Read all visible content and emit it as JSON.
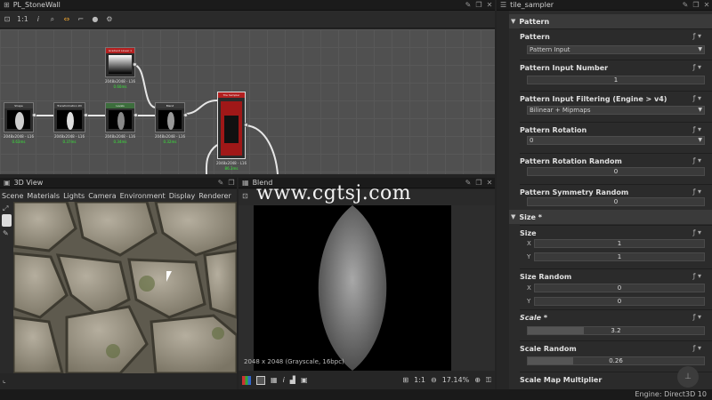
{
  "graph": {
    "title": "PL_StoneWall",
    "toolbar": [
      "1:1",
      "i",
      "⌕",
      "⇔",
      "⌐",
      "●",
      "⚙"
    ],
    "nodes": [
      {
        "header": "Gradient Linear 1",
        "label": "2048x2048 - L16",
        "time": "0.60ms"
      },
      {
        "header": "Shape",
        "label": "2048x2048 - L16",
        "time": "0.63ms"
      },
      {
        "header": "Transformation 2D",
        "label": "2048x2048 - L16",
        "time": "0.37ms"
      },
      {
        "header": "Levels",
        "label": "2048x2048 - L16",
        "time": "0.34ms"
      },
      {
        "header": "Blend",
        "label": "2048x2048 - L16",
        "time": "0.32ms"
      },
      {
        "header": "Tile Sampler",
        "label": "2048x2048 - L16",
        "time": "86.3ms"
      }
    ]
  },
  "view3d": {
    "title": "3D View",
    "menu": [
      "Scene",
      "Materials",
      "Lights",
      "Camera",
      "Environment",
      "Display",
      "Renderer"
    ]
  },
  "blend": {
    "title": "Blend",
    "info": "2048 x 2048 (Grayscale, 16bpc)",
    "zoom": "17.14%",
    "ratio": "1:1"
  },
  "watermark": "www.cgtsj.com",
  "props": {
    "title": "tile_sampler",
    "sections": [
      {
        "label": "Pattern"
      },
      {
        "label": "Size *"
      }
    ],
    "pattern": {
      "label": "Pattern",
      "value": "Pattern Input"
    },
    "pattern_input_number": {
      "label": "Pattern Input Number",
      "value": "1"
    },
    "pattern_filtering": {
      "label": "Pattern Input Filtering (Engine > v4)",
      "value": "Bilinear + Mipmaps"
    },
    "pattern_rotation": {
      "label": "Pattern Rotation",
      "value": "0"
    },
    "pattern_rotation_random": {
      "label": "Pattern Rotation Random",
      "value": "0"
    },
    "pattern_symmetry_random": {
      "label": "Pattern Symmetry Random",
      "value": "0"
    },
    "size": {
      "label": "Size",
      "x_label": "X",
      "y_label": "Y",
      "x": "1",
      "y": "1"
    },
    "size_random": {
      "label": "Size Random",
      "x_label": "X",
      "y_label": "Y",
      "x": "0",
      "y": "0"
    },
    "scale": {
      "label": "Scale *",
      "value": "3.2",
      "level": 0.32
    },
    "scale_random": {
      "label": "Scale Random",
      "value": "0.26",
      "level": 0.26
    },
    "scale_map_multiplier": {
      "label": "Scale Map Multiplier"
    }
  },
  "status": {
    "engine": "Engine: Direct3D 10"
  }
}
